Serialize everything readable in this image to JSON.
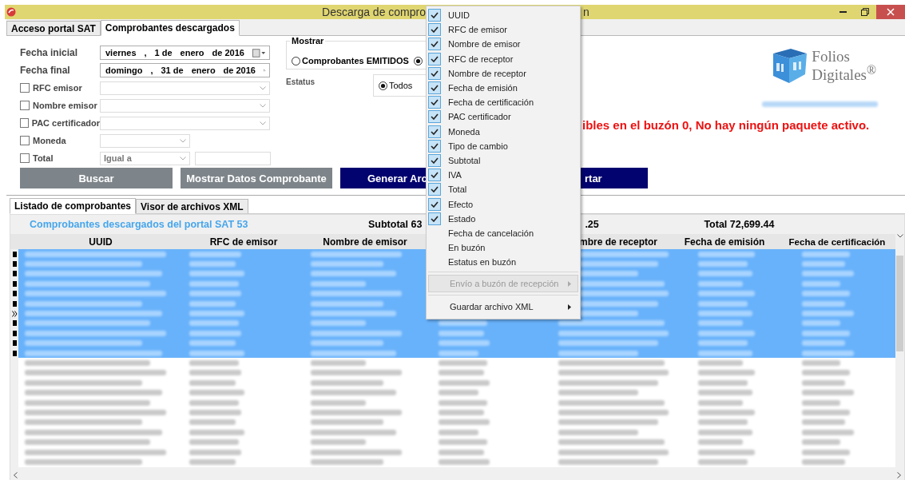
{
  "window": {
    "title_parts": [
      "Descarga de compro",
      "n"
    ]
  },
  "tabs": [
    {
      "label": "Acceso portal SAT",
      "selected": false
    },
    {
      "label": "Comprobantes descargados",
      "selected": true
    }
  ],
  "date_fields": [
    {
      "label": "Fecha inicial",
      "parts": [
        "viernes",
        ",",
        "1 de",
        "enero",
        "de 2016"
      ]
    },
    {
      "label": "Fecha final",
      "parts": [
        "domingo",
        ",",
        "31 de",
        "enero",
        "de 2016"
      ]
    }
  ],
  "filters": [
    {
      "label": "RFC emisor",
      "checked": false,
      "kind": "wide"
    },
    {
      "label": "Nombre emisor",
      "checked": false,
      "kind": "wide"
    },
    {
      "label": "PAC certificador",
      "checked": false,
      "kind": "wide"
    },
    {
      "label": "Moneda",
      "checked": false,
      "kind": "narrow"
    },
    {
      "label": "Total",
      "checked": false,
      "kind": "compare",
      "value": "Igual a"
    }
  ],
  "mostrar": {
    "legend": "Mostrar",
    "options": [
      {
        "label": "Comprobantes EMITIDOS",
        "selected": false
      },
      {
        "selected": true
      }
    ]
  },
  "estatus": {
    "label": "Estatus",
    "options": [
      {
        "label": "Todos",
        "selected": true
      }
    ]
  },
  "logo": {
    "line1": "Folios",
    "line2": "Digitales$^{®}$"
  },
  "message": "ibles en el buzón 0, No hay ningún paquete activo.",
  "buttons": [
    {
      "label": "Buscar",
      "kind": "gray"
    },
    {
      "label": "Mostrar Datos Comprobante",
      "kind": "gray"
    },
    {
      "label": "Generar Arc",
      "kind": "navy"
    },
    {
      "label": "rtar",
      "kind": "navy"
    }
  ],
  "list_tabs": [
    {
      "label": "Listado de comprobantes",
      "selected": true
    },
    {
      "label": "Visor de archivos XML",
      "selected": false
    }
  ],
  "summary": {
    "title": "Comprobantes descargados del portal SAT 53",
    "subtotal": "Subtotal 63",
    "middle": ".25",
    "total": "Total 72,699.44"
  },
  "table": {
    "columns": [
      "UUID",
      "RFC de emisor",
      "Nombre de emisor",
      "mbre de receptor",
      "Fecha de emisión",
      "Fecha de certificación"
    ],
    "rows": [
      {
        "selected": true,
        "current": false
      },
      {
        "selected": true,
        "current": false
      },
      {
        "selected": true,
        "current": false
      },
      {
        "selected": true,
        "current": false
      },
      {
        "selected": true,
        "current": false
      },
      {
        "selected": true,
        "current": false
      },
      {
        "selected": true,
        "current": true
      },
      {
        "selected": true,
        "current": false
      },
      {
        "selected": true,
        "current": false
      },
      {
        "selected": true,
        "current": false
      },
      {
        "selected": true,
        "current": false
      },
      {
        "selected": false,
        "current": false
      },
      {
        "selected": false,
        "current": false
      },
      {
        "selected": false,
        "current": false
      },
      {
        "selected": false,
        "current": false
      },
      {
        "selected": false,
        "current": false
      },
      {
        "selected": false,
        "current": false
      },
      {
        "selected": false,
        "current": false
      },
      {
        "selected": false,
        "current": false
      },
      {
        "selected": false,
        "current": false
      },
      {
        "selected": false,
        "current": false
      },
      {
        "selected": false,
        "current": false
      }
    ]
  },
  "context_menu": [
    {
      "label": "UUID",
      "kind": "check",
      "checked": true
    },
    {
      "label": "RFC de emisor",
      "kind": "check",
      "checked": true
    },
    {
      "label": "Nombre de emisor",
      "kind": "check",
      "checked": true
    },
    {
      "label": "RFC de receptor",
      "kind": "check",
      "checked": true
    },
    {
      "label": "Nombre de receptor",
      "kind": "check",
      "checked": true
    },
    {
      "label": "Fecha de emisión",
      "kind": "check",
      "checked": true
    },
    {
      "label": "Fecha de certificación",
      "kind": "check",
      "checked": true
    },
    {
      "label": "PAC certificador",
      "kind": "check",
      "checked": true
    },
    {
      "label": "Moneda",
      "kind": "check",
      "checked": true
    },
    {
      "label": "Tipo de cambio",
      "kind": "check",
      "checked": true
    },
    {
      "label": "Subtotal",
      "kind": "check",
      "checked": true
    },
    {
      "label": "IVA",
      "kind": "check",
      "checked": true
    },
    {
      "label": "Total",
      "kind": "check",
      "checked": true
    },
    {
      "label": "Efecto",
      "kind": "check",
      "checked": true
    },
    {
      "label": "Estado",
      "kind": "check",
      "checked": true
    },
    {
      "label": "Fecha de cancelación",
      "kind": "check",
      "checked": false
    },
    {
      "label": "En buzón",
      "kind": "check",
      "checked": false
    },
    {
      "label": "Estatus en buzón",
      "kind": "check",
      "checked": false
    },
    {
      "label": "Envío a buzón de recepción",
      "kind": "submenu",
      "disabled": true
    },
    {
      "label": "Guardar archivo XML",
      "kind": "submenu",
      "disabled": false
    }
  ]
}
